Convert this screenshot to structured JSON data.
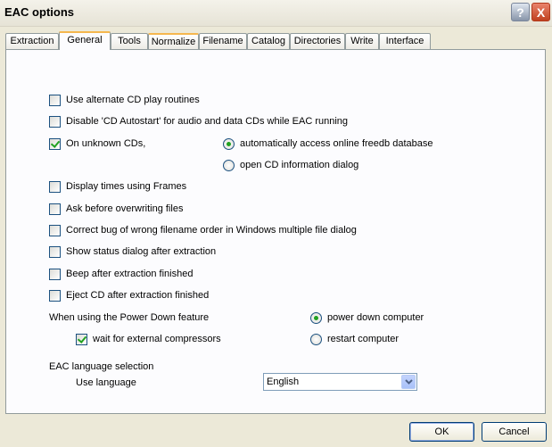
{
  "window": {
    "title": "EAC options",
    "help_label": "?",
    "close_label": "X"
  },
  "tabs": [
    {
      "label": "Extraction"
    },
    {
      "label": "General"
    },
    {
      "label": "Tools"
    },
    {
      "label": "Normalize"
    },
    {
      "label": "Filename"
    },
    {
      "label": "Catalog"
    },
    {
      "label": "Directories"
    },
    {
      "label": "Write"
    },
    {
      "label": "Interface"
    }
  ],
  "options": {
    "alt_cd_play": {
      "label": "Use alternate CD play routines",
      "checked": false
    },
    "disable_autostart": {
      "label": "Disable 'CD Autostart' for audio and data CDs while EAC running",
      "checked": false
    },
    "unknown_cds": {
      "label": "On unknown CDs,",
      "checked": true
    },
    "freedb_auto": {
      "label": "automatically access online freedb database",
      "selected": true
    },
    "open_cd_info": {
      "label": "open CD information dialog",
      "selected": false
    },
    "display_frames": {
      "label": "Display times using Frames",
      "checked": false
    },
    "ask_overwrite": {
      "label": "Ask before overwriting files",
      "checked": false
    },
    "correct_bug": {
      "label": "Correct bug of wrong filename order in Windows multiple file dialog",
      "checked": false
    },
    "show_status": {
      "label": "Show status dialog after extraction",
      "checked": false
    },
    "beep": {
      "label": "Beep after extraction finished",
      "checked": false
    },
    "eject": {
      "label": "Eject CD after extraction finished",
      "checked": false
    }
  },
  "power_down": {
    "heading": "When using the Power Down feature",
    "wait_compressors": {
      "label": "wait for external compressors",
      "checked": true
    },
    "power_down_computer": {
      "label": "power down computer",
      "selected": true
    },
    "restart_computer": {
      "label": "restart computer",
      "selected": false
    }
  },
  "language": {
    "heading": "EAC language selection",
    "use_label": "Use language",
    "selected": "English"
  },
  "buttons": {
    "ok": "OK",
    "cancel": "Cancel"
  },
  "icons": {
    "dropdown": "chevron-down-icon"
  }
}
